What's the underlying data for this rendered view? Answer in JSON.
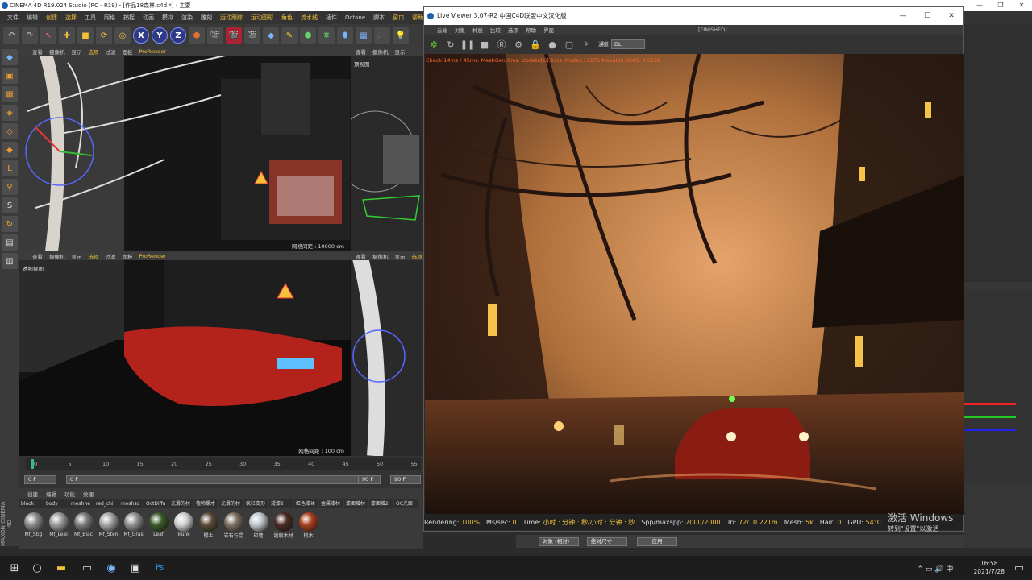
{
  "c4d": {
    "title": "CINEMA 4D R19.024 Studio (RC - R19) - [作品18森林.c4d *] - 主要",
    "menu": [
      "文件",
      "编辑",
      "创建",
      "选择",
      "工具",
      "网格",
      "捕捉",
      "动画",
      "模拟",
      "渲染",
      "雕刻",
      "运动跟踪",
      "运动图形",
      "角色",
      "流水线",
      "插件",
      "Octane",
      "脚本",
      "窗口",
      "帮助"
    ],
    "menu_highlight": [
      "创建",
      "选择",
      "运动跟踪",
      "运动图形",
      "角色",
      "流水线",
      "窗口",
      "帮助"
    ],
    "toolbar_xyz": [
      "X",
      "Y",
      "Z"
    ],
    "window_buttons": [
      "—",
      "❐",
      "✕"
    ]
  },
  "viewports": {
    "tl": {
      "menu": [
        "查看",
        "摄像机",
        "显示",
        "选项",
        "过滤",
        "面板",
        "ProRender"
      ],
      "grid": "网格间距 : 10000 cm"
    },
    "tr": {
      "menu": [
        "查看",
        "摄像机",
        "显示"
      ],
      "label": "顶视图"
    },
    "bl": {
      "menu": [
        "查看",
        "摄像机",
        "显示",
        "选项",
        "过滤",
        "面板",
        "ProRender"
      ],
      "label": "透视视图",
      "grid": "网格间距 : 100 cm"
    },
    "br": {
      "menu": [
        "查看",
        "摄像机",
        "显示",
        "选项"
      ]
    }
  },
  "timeline": {
    "ticks": [
      "0",
      "5",
      "10",
      "15",
      "20",
      "25",
      "30",
      "35",
      "40",
      "45",
      "50",
      "55"
    ],
    "frame_left": "0 F",
    "frame_mid": "0 F",
    "frame_end": "90 F",
    "frame_end2": "90 F"
  },
  "materials": {
    "tabs": [
      "创建",
      "编辑",
      "功能",
      "纹理"
    ],
    "names_row": [
      "black",
      "body",
      "meshhe",
      "red_chi",
      "meshsq",
      "OctDiffu",
      "光滑的材",
      "植物螺才",
      "光滑的材",
      "疯狂变形",
      "漫漆2",
      "红色漆丝",
      "金属漆材",
      "漆面增材",
      "漆面增2",
      "OC光面"
    ],
    "balls": [
      {
        "name": "Mf_Stig",
        "color": "#8a8a8a"
      },
      {
        "name": "Mf_Leal",
        "color": "#9a9a9a"
      },
      {
        "name": "Mf_Blac",
        "color": "#7a7a7a"
      },
      {
        "name": "Mf_Sten",
        "color": "#a5a5a5"
      },
      {
        "name": "Mf_Gras",
        "color": "#909090"
      },
      {
        "name": "Leaf",
        "color": "#3c5a2a"
      },
      {
        "name": "Trunk",
        "color": "#cfcfcf"
      },
      {
        "name": "樱土",
        "color": "#5a4a38"
      },
      {
        "name": "岩石与混",
        "color": "#7d7060"
      },
      {
        "name": "印墙",
        "color": "#bfc6cc"
      },
      {
        "name": "划痕木材",
        "color": "#4a2a22"
      },
      {
        "name": "桃木",
        "color": "#a8401e"
      }
    ],
    "brand": "MAXON CINEMA 4D"
  },
  "live_viewer": {
    "title": "Live Viewer 3.07-R2 中国C4D联盟中文汉化版",
    "menu": [
      "云端",
      "对象",
      "材质",
      "比较",
      "选项",
      "帮助",
      "界面"
    ],
    "status": "[FINISHED]",
    "channel_label": "通道:",
    "channel_value": "DL",
    "overlay": "Check:14ms / 45ms. MeshGen:0ms. Update[G]:1ms. Nodes:10276 Movable:3645. 0 5132",
    "stats": [
      {
        "k": "Rendering:",
        "v": "100%"
      },
      {
        "k": "Ms/sec:",
        "v": "0"
      },
      {
        "k": "Time:",
        "v": "小时 : 分钟 : 秒/小时 : 分钟 : 秒"
      },
      {
        "k": "Spp/maxspp:",
        "v": "2000/2000"
      },
      {
        "k": "Tri:",
        "v": "72/10.221m"
      },
      {
        "k": "Mesh:",
        "v": "5k"
      },
      {
        "k": "Hair:",
        "v": "0"
      },
      {
        "k": "GPU:",
        "v": "54°C"
      }
    ],
    "window_buttons": [
      "—",
      "☐",
      "✕"
    ]
  },
  "coords": {
    "object": "对象 (相对)",
    "size": "绝对尺寸",
    "apply": "应用"
  },
  "activation": {
    "line1": "激活 Windows",
    "line2": "转到\"设置\"以激活 Windows。"
  },
  "taskbar": {
    "time": "16:58",
    "date": "2021/7/28"
  },
  "colors": {
    "accent": "#f3c13a",
    "render_warm": "#c47a3c",
    "overlay_text": "#ff6a2a"
  }
}
